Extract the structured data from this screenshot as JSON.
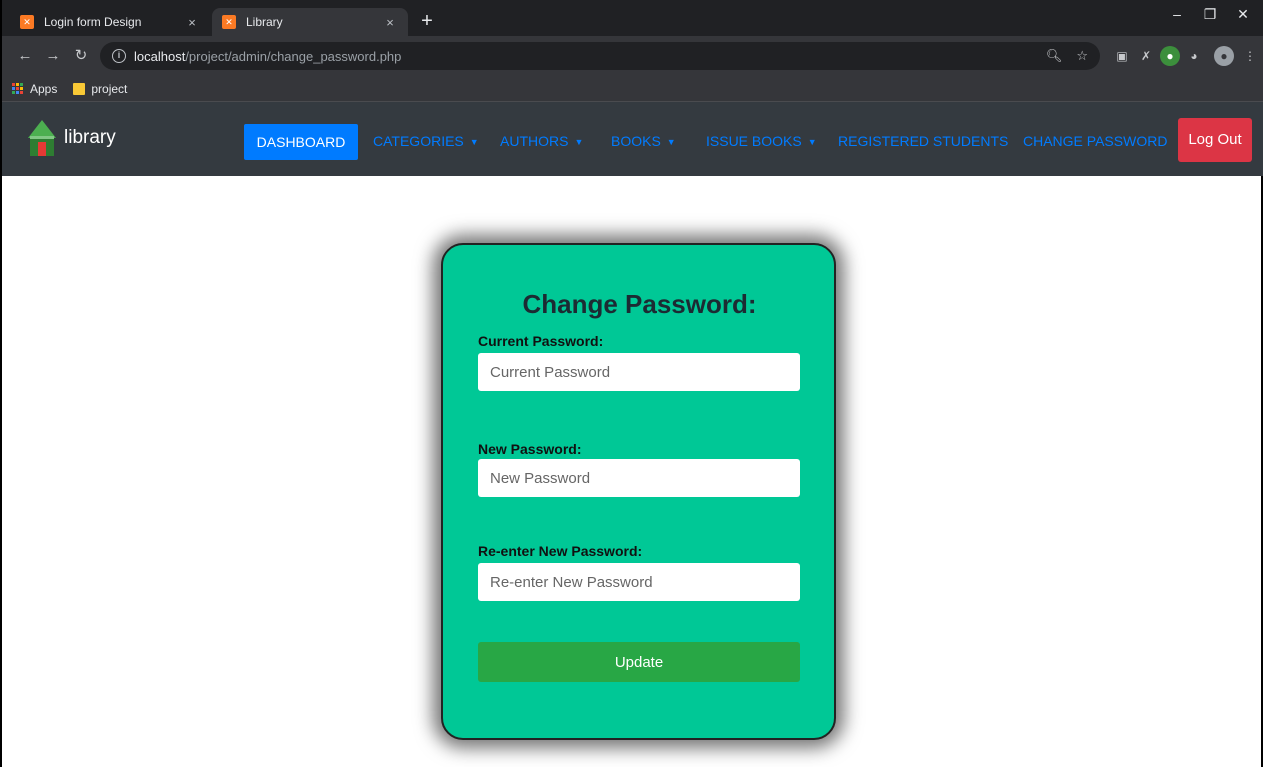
{
  "browser": {
    "tabs": [
      {
        "title": "Login form Design",
        "active": false
      },
      {
        "title": "Library",
        "active": true
      }
    ],
    "url_host": "localhost",
    "url_path": "/project/admin/change_password.php",
    "bookmarks": [
      {
        "label": "Apps",
        "icon": "apps-grid-icon"
      },
      {
        "label": "project",
        "icon": "folder-icon"
      }
    ],
    "colors": {
      "tab_bg": "#202124",
      "toolbar_bg": "#35363a",
      "favicon": "#fb7a24"
    }
  },
  "navbar": {
    "brand": "library",
    "items": [
      {
        "label": "DASHBOARD",
        "active": true
      },
      {
        "label": "CATEGORIES",
        "dropdown": true
      },
      {
        "label": "AUTHORS",
        "dropdown": true
      },
      {
        "label": "BOOKS",
        "dropdown": true
      },
      {
        "label": "ISSUE BOOKS",
        "dropdown": true
      },
      {
        "label": "REGISTERED STUDENTS"
      },
      {
        "label": "CHANGE PASSWORD"
      }
    ],
    "logout_label": "Log Out",
    "colors": {
      "bg": "#343a40",
      "link": "#007bff",
      "logout": "#dc3545"
    }
  },
  "form": {
    "title": "Change Password:",
    "current_label": "Current Password:",
    "current_placeholder": "Current Password",
    "new_label": "New Password:",
    "new_placeholder": "New Password",
    "reenter_label": "Re-enter New Password:",
    "reenter_placeholder": "Re-enter New Password",
    "submit_label": "Update",
    "colors": {
      "card_bg": "#00c896",
      "button": "#28a745"
    }
  }
}
